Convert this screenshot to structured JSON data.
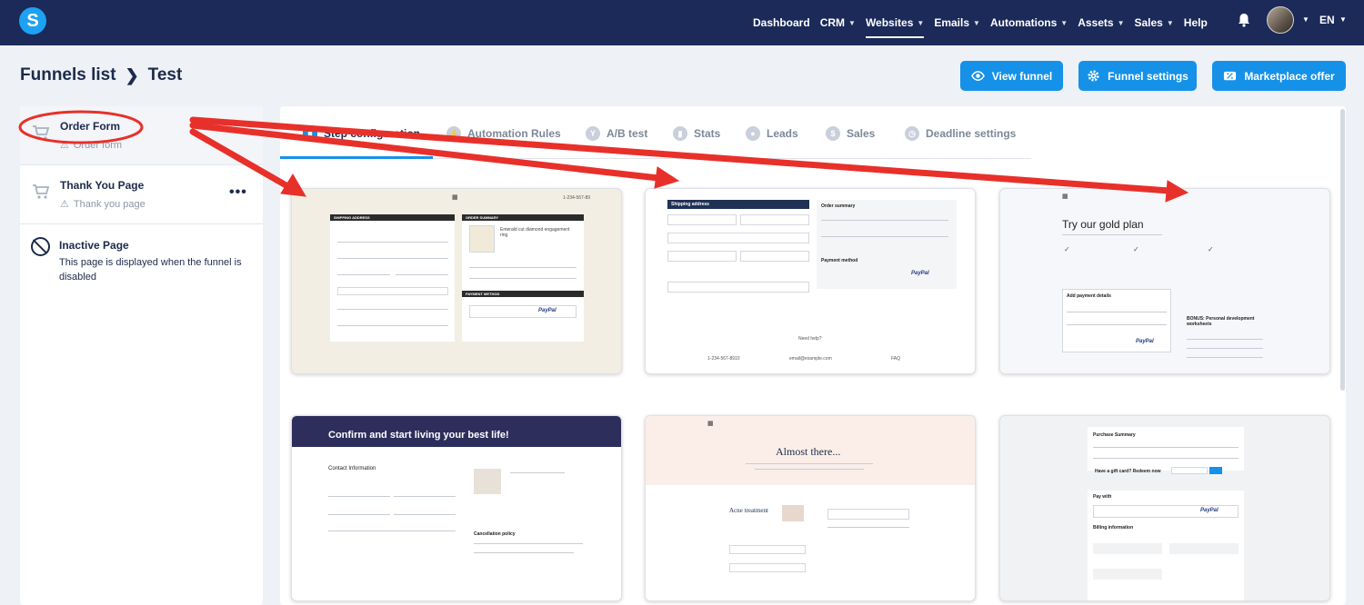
{
  "nav": {
    "items": [
      "Dashboard",
      "CRM",
      "Websites",
      "Emails",
      "Automations",
      "Assets",
      "Sales",
      "Help"
    ],
    "lang": "EN"
  },
  "breadcrumb": {
    "root": "Funnels list",
    "current": "Test"
  },
  "header_buttons": {
    "view": "View funnel",
    "settings": "Funnel settings",
    "marketplace": "Marketplace offer"
  },
  "steps": [
    {
      "title": "Order Form",
      "sub": "Order form"
    },
    {
      "title": "Thank You Page",
      "sub": "Thank you page"
    },
    {
      "title": "Inactive Page",
      "desc": "This page is displayed when the funnel is disabled"
    }
  ],
  "tabs": [
    "Step configuration",
    "Automation Rules",
    "A/B test",
    "Stats",
    "Leads",
    "Sales",
    "Deadline settings"
  ],
  "templates": {
    "t1": {
      "phone": "1-234-567-89",
      "ship": "SHIPPING ADDRESS",
      "order": "ORDER SUMMARY",
      "product": "Emerald cut diamond engagement ring",
      "pay": "PAYMENT METHOD",
      "paypal": "PayPal"
    },
    "t2": {
      "ship": "Shipping address",
      "order": "Order summary",
      "pay": "Payment method",
      "paypal": "PayPal",
      "help": "Need help?",
      "phone": "1-234-567-8910",
      "email": "email@example.com",
      "faq": "FAQ"
    },
    "t3": {
      "title": "Try our gold plan",
      "pay": "Add payment details",
      "bonus": "BONUS: Personal development worksheets",
      "paypal": "PayPal"
    },
    "t4": {
      "title": "Confirm and start living your best life!",
      "contact": "Contact Information",
      "cancel": "Cancellation policy"
    },
    "t5": {
      "title": "Almost there...",
      "product": "Acne treatment"
    },
    "t6": {
      "summary": "Purchase Summary",
      "gift": "Have a gift card? Redeem now",
      "payw": "Pay with",
      "billing": "Billing information",
      "paypal": "PayPal"
    }
  },
  "colors": {
    "nav": "#1b2a58",
    "accent": "#1591e8",
    "annotation": "#e8302a"
  }
}
